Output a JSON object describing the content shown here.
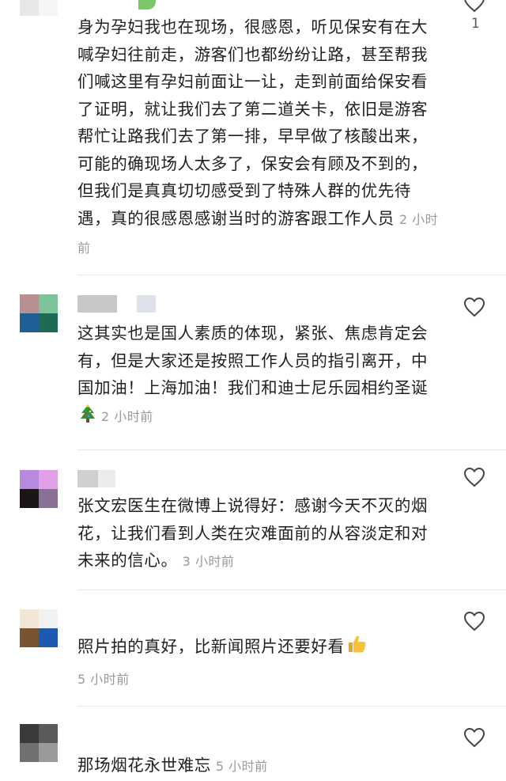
{
  "comments": [
    {
      "text": "身为孕妇我也在现场，很感恩，听见保安有在大喊孕妇往前走，游客们也都纷纷让路，甚至帮我们喊这里有孕妇前面让一让，走到前面给保安看了证明，就让我们去了第二道关卡，依旧是游客帮忙让路我们去了第一排，早早做了核酸出来，可能的确现场人太多了，保安会有顾及不到的，但我们是真真切切感受到了特殊人群的优先待遇，真的很感恩感谢当时的游客跟工作人员",
      "time": "2 小时前",
      "likes": "1",
      "avatar_colors": [
        "#d9d9d9",
        "#f0f0f0",
        "#e8e8e8",
        "#f5f5f5"
      ]
    },
    {
      "text": "这其实也是国人素质的体现，紧张、焦虑肯定会有，但是大家还是按照工作人员的指引离开，中国加油！上海加油！我们和迪士尼乐园相约圣诞",
      "emoji": "christmas-tree-icon",
      "time": "2 小时前",
      "avatar_colors": [
        "#b89090",
        "#7fc39a",
        "#1f5f96",
        "#1e6b55"
      ]
    },
    {
      "text": "张文宏医生在微博上说得好：感谢今天不灭的烟花，让我们看到人类在灾难面前的从容淡定和对未来的信心。",
      "time": "3 小时前",
      "avatar_colors": [
        "#b78ae0",
        "#e2a0e8",
        "#1c1518",
        "#8a6f96"
      ]
    },
    {
      "text": "照片拍的真好，比新闻照片还要好看",
      "emoji": "thumbs-up-icon",
      "time": "5 小时前",
      "avatar_colors": [
        "#f3e6d6",
        "#f2f2f2",
        "#7a5430",
        "#1f58b0"
      ]
    },
    {
      "text": "那场烟花永世难忘",
      "time": "5 小时前",
      "avatar_colors": [
        "#3a3a3a",
        "#5a5a5a",
        "#707070",
        "#9a9a9a"
      ]
    }
  ]
}
